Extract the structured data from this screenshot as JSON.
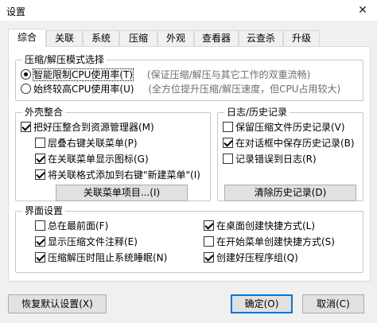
{
  "window": {
    "title": "设置",
    "close_glyph": "✕"
  },
  "tabs": [
    {
      "label": "综合"
    },
    {
      "label": "关联"
    },
    {
      "label": "系统"
    },
    {
      "label": "压缩"
    },
    {
      "label": "外观"
    },
    {
      "label": "查看器"
    },
    {
      "label": "云查杀"
    },
    {
      "label": "升级"
    }
  ],
  "mode_group": {
    "title": "压缩/解压模式选择",
    "options": [
      {
        "label": "智能限制CPU使用率(T)",
        "hint": "(保证压缩/解压与其它工作的双重流畅)",
        "selected": true
      },
      {
        "label": "始终较高CPU使用率(U)",
        "hint": "(全方位提升压缩/解压速度，但CPU占用较大)",
        "selected": false
      }
    ]
  },
  "shell_group": {
    "title": "外壳整合",
    "items": [
      {
        "label": "把好压整合到资源管理器(M)",
        "checked": true
      },
      {
        "label": "层叠右键关联菜单(P)",
        "checked": false
      },
      {
        "label": "在关联菜单显示图标(G)",
        "checked": true
      },
      {
        "label": "将关联格式添加到右键\"新建菜单\"(I)",
        "checked": true
      }
    ],
    "button": "关联菜单项目...(I)"
  },
  "log_group": {
    "title": "日志/历史记录",
    "items": [
      {
        "label": "保留压缩文件历史记录(V)",
        "checked": false
      },
      {
        "label": "在对话框中保存历史记录(B)",
        "checked": true
      },
      {
        "label": "记录错误到日志(R)",
        "checked": false
      }
    ],
    "button": "清除历史记录(D)"
  },
  "ui_group": {
    "title": "界面设置",
    "left": [
      {
        "label": "总在最前面(F)",
        "checked": false
      },
      {
        "label": "显示压缩文件注释(E)",
        "checked": true
      },
      {
        "label": "压缩解压时阻止系统睡眠(N)",
        "checked": true
      }
    ],
    "right": [
      {
        "label": "在桌面创建快捷方式(L)",
        "checked": true
      },
      {
        "label": "在开始菜单创建快捷方式(S)",
        "checked": false
      },
      {
        "label": "创建好压程序组(Q)",
        "checked": true
      }
    ]
  },
  "footer": {
    "restore": "恢复默认设置(X)",
    "ok": "确定(O)",
    "cancel": "取消(C)"
  },
  "colors": {
    "accent": "#0078d7",
    "panel": "#ffffff",
    "window": "#f0f0f0"
  }
}
